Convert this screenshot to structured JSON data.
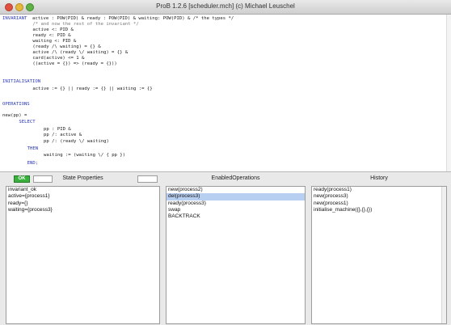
{
  "window": {
    "title": "ProB 1.2.6  [scheduler.mch]  (c) Michael Leuschel"
  },
  "editor": {
    "lines": [
      {
        "indent": 0,
        "segments": [
          {
            "t": "INVARIANT",
            "c": "kw"
          },
          {
            "t": "  active : POW(PID) & ready : POW(PID) & waiting: POW(PID) & /* the types */",
            "c": ""
          }
        ]
      },
      {
        "indent": 11,
        "segments": [
          {
            "t": "/* and now the rest of the invariant */",
            "c": "cm"
          }
        ]
      },
      {
        "indent": 11,
        "segments": [
          {
            "t": "active <: PID &",
            "c": ""
          }
        ]
      },
      {
        "indent": 11,
        "segments": [
          {
            "t": "ready <: PID &",
            "c": ""
          }
        ]
      },
      {
        "indent": 11,
        "segments": [
          {
            "t": "waiting <: PID &",
            "c": ""
          }
        ]
      },
      {
        "indent": 11,
        "segments": [
          {
            "t": "(ready /\\ waiting) = {} &",
            "c": ""
          }
        ]
      },
      {
        "indent": 11,
        "segments": [
          {
            "t": "active /\\ (ready \\/ waiting) = {} &",
            "c": ""
          }
        ]
      },
      {
        "indent": 11,
        "segments": [
          {
            "t": "card(active) <= 1 &",
            "c": ""
          }
        ]
      },
      {
        "indent": 11,
        "segments": [
          {
            "t": "((active = {}) => (ready = {}))",
            "c": ""
          }
        ]
      },
      {
        "indent": 0,
        "segments": [
          {
            "t": "",
            "c": ""
          }
        ]
      },
      {
        "indent": 0,
        "segments": [
          {
            "t": "INITIALISATION",
            "c": "kw"
          }
        ]
      },
      {
        "indent": 11,
        "segments": [
          {
            "t": "active := {} || ready := {} || waiting := {}",
            "c": ""
          }
        ]
      },
      {
        "indent": 0,
        "segments": [
          {
            "t": "",
            "c": ""
          }
        ]
      },
      {
        "indent": 0,
        "segments": [
          {
            "t": "OPERATIONS",
            "c": "kw"
          }
        ]
      },
      {
        "indent": 0,
        "segments": [
          {
            "t": "",
            "c": ""
          }
        ]
      },
      {
        "indent": 0,
        "segments": [
          {
            "t": "new(pp) =",
            "c": ""
          }
        ]
      },
      {
        "indent": 6,
        "segments": [
          {
            "t": "SELECT",
            "c": "kw"
          }
        ]
      },
      {
        "indent": 15,
        "segments": [
          {
            "t": "pp : PID &",
            "c": ""
          }
        ]
      },
      {
        "indent": 15,
        "segments": [
          {
            "t": "pp /: active &",
            "c": ""
          }
        ]
      },
      {
        "indent": 15,
        "segments": [
          {
            "t": "pp /: (ready \\/ waiting)",
            "c": ""
          }
        ]
      },
      {
        "indent": 9,
        "segments": [
          {
            "t": "THEN",
            "c": "kw"
          }
        ]
      },
      {
        "indent": 15,
        "segments": [
          {
            "t": "waiting := (waiting \\/ { pp })",
            "c": ""
          }
        ]
      },
      {
        "indent": 9,
        "segments": [
          {
            "t": "END;",
            "c": "kw"
          }
        ]
      }
    ]
  },
  "state_panel": {
    "ok_label": "OK",
    "header": "State Properties",
    "items": [
      "invariant_ok",
      "active={process1}",
      "ready={}",
      "waiting={process3}"
    ]
  },
  "enabled_panel": {
    "header": "EnabledOperations",
    "selected_index": 1,
    "items": [
      "new(process2)",
      "del(process3)",
      "ready(process3)",
      "swap",
      "BACKTRACK"
    ]
  },
  "history_panel": {
    "header": "History",
    "items": [
      "ready(process1)",
      "new(process3)",
      "new(process1)",
      "initialise_machine({},{},{})"
    ]
  },
  "colors": {
    "keyword": "#2a38b8",
    "comment": "#7a7a7a",
    "ok_green": "#39b23d",
    "selection": "#b7cff0"
  }
}
